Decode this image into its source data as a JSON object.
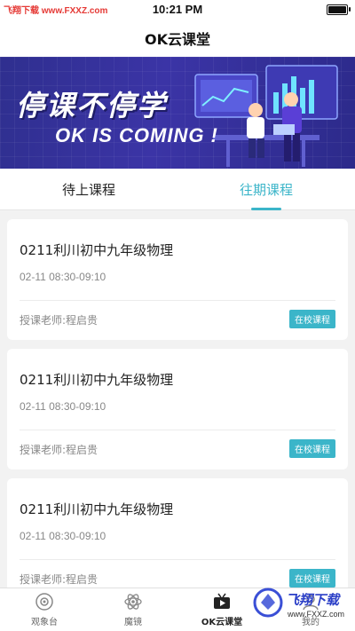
{
  "status_bar": {
    "watermark": "飞翔下载 www.FXXZ.com",
    "time": "10:21 PM"
  },
  "nav": {
    "title": "OK云课堂"
  },
  "banner": {
    "headline": "停课不停学",
    "subtitle": "OK IS COMING !"
  },
  "tabs": [
    {
      "label": "待上课程",
      "active": false
    },
    {
      "label": "往期课程",
      "active": true
    }
  ],
  "courses": [
    {
      "title": "0211利川初中九年级物理",
      "time": "02-11 08:30-09:10",
      "teacher": "授课老师:程启贵",
      "badge": "在校课程"
    },
    {
      "title": "0211利川初中九年级物理",
      "time": "02-11 08:30-09:10",
      "teacher": "授课老师:程启贵",
      "badge": "在校课程"
    },
    {
      "title": "0211利川初中九年级物理",
      "time": "02-11 08:30-09:10",
      "teacher": "授课老师:程启贵",
      "badge": "在校课程"
    }
  ],
  "tabbar": [
    {
      "label": "观象台",
      "icon": "observatory-icon"
    },
    {
      "label": "魔镜",
      "icon": "magic-mirror-icon"
    },
    {
      "label": "OK云课堂",
      "icon": "tv-icon",
      "active": true
    },
    {
      "label": "我的",
      "icon": "profile-icon"
    }
  ],
  "watermark_logo": {
    "text": "飞翔下载",
    "url": "www.FXXZ.com"
  },
  "colors": {
    "accent": "#3bb5c9",
    "banner": "#3b34a6"
  }
}
